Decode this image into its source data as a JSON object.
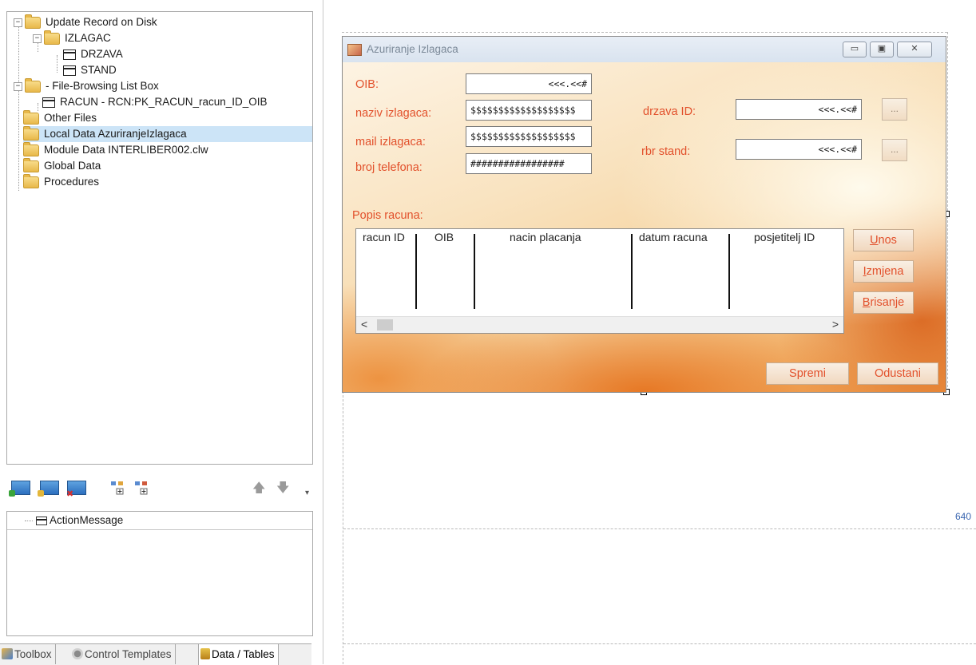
{
  "tree": {
    "items": [
      {
        "label": "Update Record on Disk",
        "expander": "−"
      },
      {
        "label": "IZLAGAC",
        "expander": "−"
      },
      {
        "label": "DRZAVA"
      },
      {
        "label": "STAND"
      },
      {
        "label": "- File-Browsing List Box",
        "expander": "−"
      },
      {
        "label": "RACUN - RCN:PK_RACUN_racun_ID_OIB"
      },
      {
        "label": "Other Files"
      },
      {
        "label": "Local Data AzuriranjeIzlagaca"
      },
      {
        "label": "Module Data INTERLIBER002.clw"
      },
      {
        "label": "Global Data"
      },
      {
        "label": "Procedures"
      }
    ]
  },
  "action_panel": {
    "header": "ActionMessage"
  },
  "bottom_tabs": [
    "Toolbox",
    "Control Templates",
    "Data / Tables"
  ],
  "ruler_label": "640",
  "dialog": {
    "title": "Azuriranje Izlagaca",
    "window_buttons": {
      "minimize": "▭",
      "maximize": "▣",
      "close": "✕"
    },
    "labels": {
      "oib": "OIB:",
      "naziv": "naziv izlagaca:",
      "mail": "mail izlagaca:",
      "telefon": "broj telefona:",
      "drzava": "drzava ID:",
      "stand": "rbr stand:",
      "popis": "Popis racuna:"
    },
    "fields": {
      "oib": "<<<.<<#",
      "naziv": "$$$$$$$$$$$$$$$$$$$",
      "mail": "$$$$$$$$$$$$$$$$$$$",
      "telefon": "#################",
      "drzava": "<<<.<<#",
      "stand": "<<<.<<#"
    },
    "lookup_label": "...",
    "grid": {
      "columns": [
        "racun ID",
        "OIB",
        "nacin placanja",
        "datum racuna",
        "posjetitelj ID"
      ],
      "scroll_left": "<",
      "scroll_right": ">"
    },
    "buttons": {
      "unos_first": "U",
      "unos_rest": "nos",
      "izmjena_first": "I",
      "izmjena_rest": "zmjena",
      "brisanje_first": "B",
      "brisanje_rest": "risanje",
      "spremi": "Spremi",
      "odustani": "Odustani"
    }
  },
  "colors": {
    "label_accent": "#e2502b",
    "selection": "#cce4f7"
  }
}
